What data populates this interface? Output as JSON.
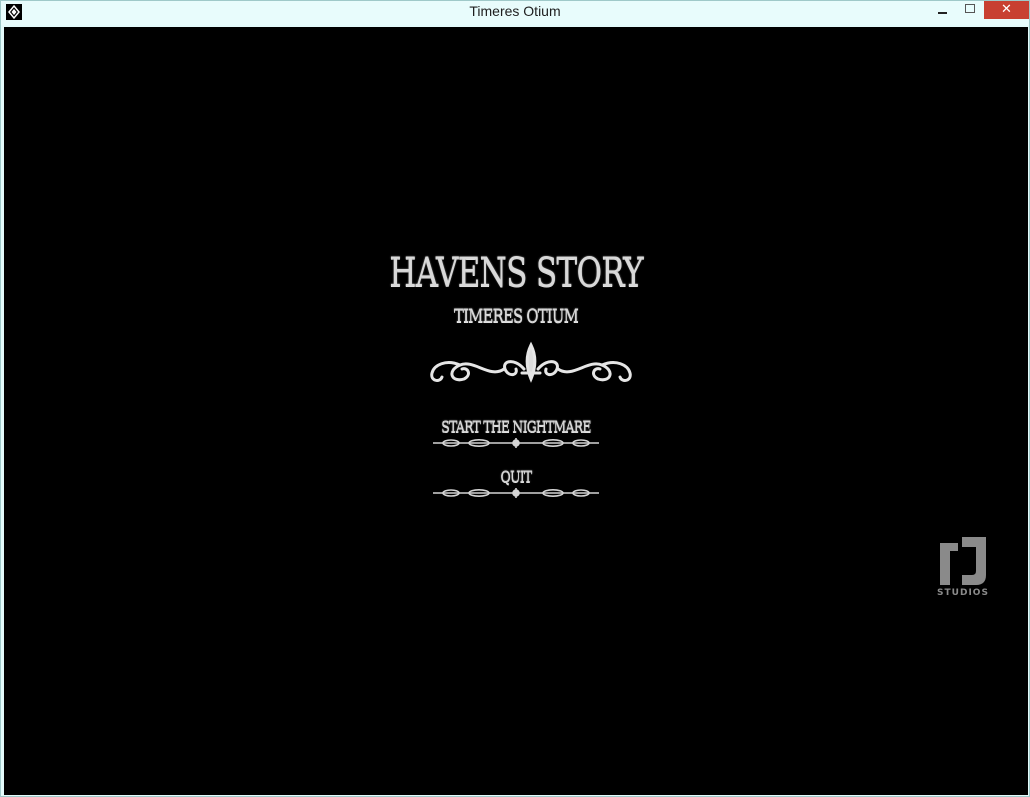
{
  "window": {
    "title": "Timeres Otium",
    "close_glyph": "✕"
  },
  "game": {
    "title": "Havens Story",
    "subtitle": "Timeres Otium",
    "menu": [
      {
        "label": "Start The Nightmare"
      },
      {
        "label": "Quit"
      }
    ]
  },
  "studio": {
    "label": "STUDIOS"
  },
  "colors": {
    "canvas": "#000000",
    "text": "#d9d9d9",
    "titlebar": "#e8fcfc",
    "close_button": "#c84031",
    "studio_logo": "#8a8a8a"
  },
  "icons": {
    "app": "diamond-emblem-icon",
    "ornament": "fleur-de-lis-scroll-ornament",
    "studio": "rj-studios-logo"
  }
}
